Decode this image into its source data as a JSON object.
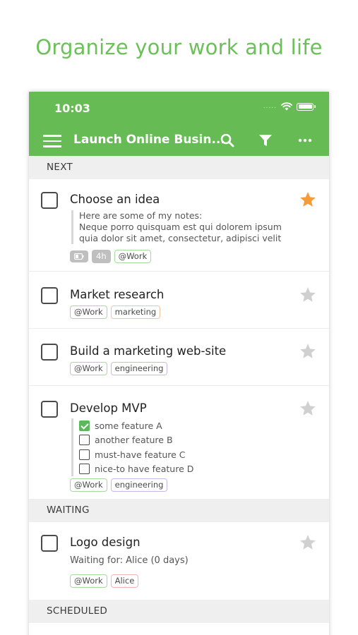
{
  "headline": "Organize your work and life",
  "status": {
    "time": "10:03",
    "signal": "....."
  },
  "toolbar": {
    "title": "Launch Online Busin..."
  },
  "icons": {
    "menu": "hamburger-icon",
    "search": "search-icon",
    "filter": "filter-icon",
    "more": "more-icon"
  },
  "colors": {
    "accent": "#66bb55",
    "headline": "#6cc05a",
    "star_active": "#f59b3a",
    "star_inactive": "#d0d0d0"
  },
  "sections": {
    "next": "NEXT",
    "waiting": "WAITING",
    "scheduled": "SCHEDULED"
  },
  "tasks": {
    "t1": {
      "title": "Choose an idea",
      "note": [
        "Here are some of my notes:",
        "Neque porro quisquam est qui dolorem ipsum",
        "quia dolor sit amet, consectetur, adipisci velit"
      ],
      "duration": "4h",
      "context": "@Work",
      "starred": true
    },
    "t2": {
      "title": "Market research",
      "context": "@Work",
      "tag": "marketing",
      "starred": false
    },
    "t3": {
      "title": "Build a marketing web-site",
      "context": "@Work",
      "tag": "engineering",
      "starred": false
    },
    "t4": {
      "title": "Develop MVP",
      "checklist": [
        {
          "label": "some feature A",
          "checked": true
        },
        {
          "label": "another feature B",
          "checked": false
        },
        {
          "label": "must-have feature C",
          "checked": false
        },
        {
          "label": "nice-to have feature D",
          "checked": false
        }
      ],
      "context": "@Work",
      "tag": "engineering",
      "starred": false
    },
    "t5": {
      "title": "Logo design",
      "waiting_for": "Waiting for: Alice (0 days)",
      "context": "@Work",
      "person": "Alice",
      "starred": false
    }
  }
}
